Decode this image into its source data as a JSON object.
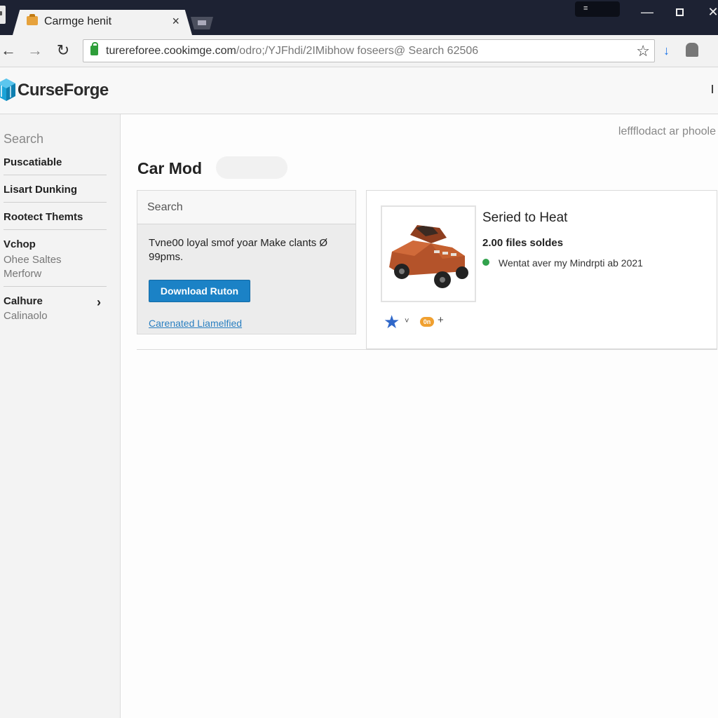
{
  "browser": {
    "tab_title": "Carmge henit",
    "tab_close": "×",
    "profile_label": "≡",
    "window_min": "—",
    "window_close": "✕",
    "nav_back": "←",
    "nav_forward": "→",
    "nav_reload": "↻",
    "url_main": "turereforee.cookimge.com",
    "url_rest": "/odro;/YJFhdi/2IMibhow foseers@ Search 62506",
    "bookmark_star": "☆",
    "download_icon": "↓",
    "menu_dots": "⋮"
  },
  "site": {
    "logo_text": "CurseForge",
    "brand_color": "#1aa3d8"
  },
  "sidebar": {
    "search_label": "Search",
    "items": [
      {
        "label": "Puscatiable"
      },
      {
        "label": "Lisart Dunking"
      },
      {
        "label": "Rootect Themts"
      },
      {
        "label": "Vchop",
        "sub": [
          "Ohee Saltes",
          "Merforw"
        ]
      },
      {
        "label": "Calhure",
        "sub": [
          "Calinaolo"
        ]
      }
    ],
    "chevron": "›"
  },
  "main": {
    "top_right_link": "leffflodact ar phoole",
    "page_title": "Car Mod",
    "left_card": {
      "search_placeholder": "Search",
      "description": "Tvne00 loyal smof yoar Make clants Ø 99pms.",
      "button_label": "Download Ruton",
      "link_label": "Carenated Liamelfied"
    },
    "product": {
      "title": "Seried to Heat",
      "files": "2.00 files soldes",
      "updated": "Wentat aver my Mindrpti ab 2021",
      "status_color": "#31a24c",
      "fav_icon": "★",
      "caret": "˅",
      "badge_text": "0n",
      "plus": "+"
    }
  }
}
